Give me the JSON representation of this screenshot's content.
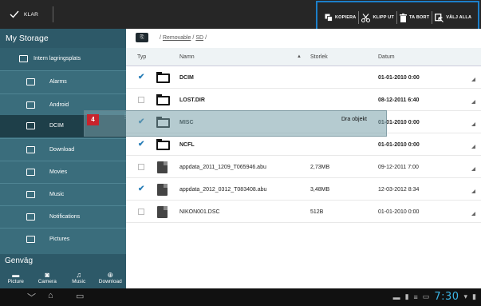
{
  "topbar": {
    "done_label": "KLAR",
    "actions": [
      {
        "label": "KOPIERA",
        "icon": "copy-icon"
      },
      {
        "label": "KLIPP UT",
        "icon": "scissors-icon"
      },
      {
        "label": "TA BORT",
        "icon": "trash-icon"
      },
      {
        "label": "VÄLJ ALLA",
        "icon": "select-all-icon"
      }
    ]
  },
  "sidebar": {
    "title": "My Storage",
    "root": "Intern lagringsplats",
    "items": [
      "Alarms",
      "Android",
      "DCIM",
      "Download",
      "Movies",
      "Music",
      "Notifications",
      "Pictures"
    ],
    "shortcut_title": "Genväg",
    "shortcuts": [
      {
        "label": "Picture",
        "icon": "image-icon"
      },
      {
        "label": "Camera",
        "icon": "camera-icon"
      },
      {
        "label": "Music",
        "icon": "music-icon"
      },
      {
        "label": "Download",
        "icon": "download-icon"
      }
    ]
  },
  "path": {
    "sep": "/",
    "parts": [
      "Removable",
      "SD"
    ]
  },
  "columns": {
    "type": "Typ",
    "name": "Namn",
    "size": "Storlek",
    "date": "Datum"
  },
  "rows": [
    {
      "checked": true,
      "kind": "folder",
      "name": "DCIM",
      "size": "",
      "date": "01-01-2010 0:00",
      "bold": true
    },
    {
      "checked": false,
      "kind": "folder",
      "name": "LOST.DIR",
      "size": "",
      "date": "08-12-2011 6:40",
      "bold": true
    },
    {
      "checked": true,
      "kind": "folder",
      "name": "MISC",
      "size": "",
      "date": "01-01-2010 0:00",
      "bold": true
    },
    {
      "checked": true,
      "kind": "folder",
      "name": "NCFL",
      "size": "",
      "date": "01-01-2010 0:00",
      "bold": true
    },
    {
      "checked": false,
      "kind": "file",
      "name": "appdata_2011_1209_T065946.abu",
      "size": "2,73MB",
      "date": "09-12-2011 7:00",
      "bold": false
    },
    {
      "checked": true,
      "kind": "file",
      "name": "appdata_2012_0312_T083408.abu",
      "size": "3,48MB",
      "date": "12-03-2012 8:34",
      "bold": false
    },
    {
      "checked": false,
      "kind": "file",
      "name": "NIKON001.DSC",
      "size": "512B",
      "date": "01-01-2010 0:00",
      "bold": false
    }
  ],
  "drag": {
    "count": "4",
    "label": "Dra objekt"
  },
  "navbar": {
    "clock": "7:30"
  }
}
